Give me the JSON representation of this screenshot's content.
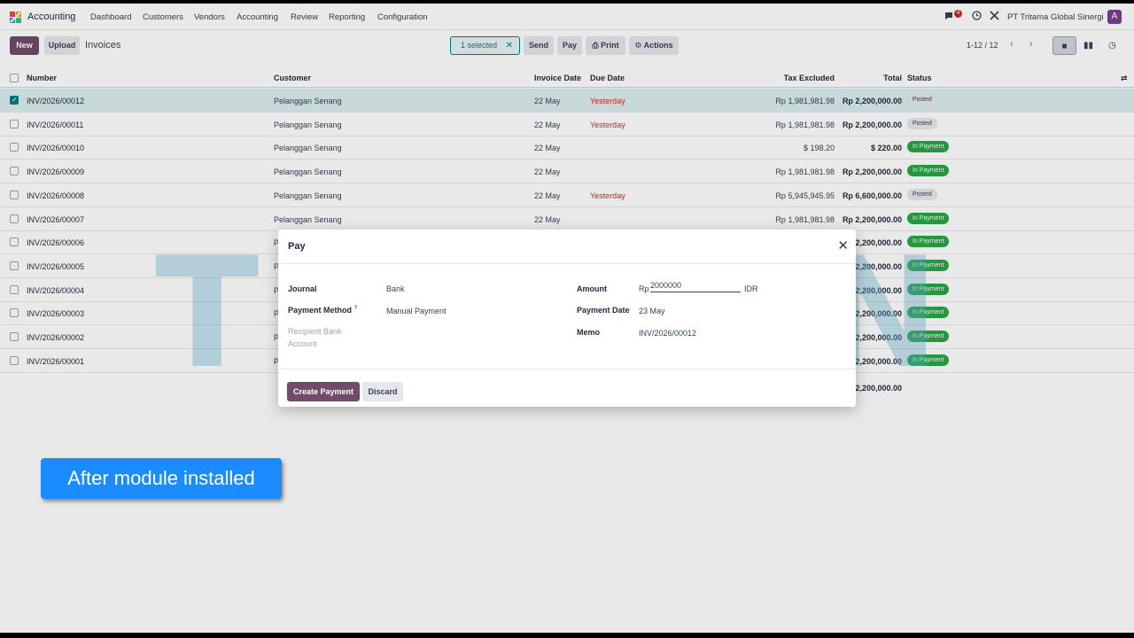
{
  "navbar": {
    "app_name": "Accounting",
    "menu": [
      "Dashboard",
      "Customers",
      "Vendors",
      "Accounting",
      "Review",
      "Reporting",
      "Configuration"
    ],
    "chat_badge": "4",
    "company": "PT Tritama Global Sinergi",
    "avatar_letter": "A"
  },
  "control": {
    "new_label": "New",
    "upload_label": "Upload",
    "title": "Invoices",
    "selected_label": "1 selected",
    "send_label": "Send",
    "pay_label": "Pay",
    "print_label": "Print",
    "actions_label": "Actions",
    "pager": "1-12 / 12"
  },
  "table": {
    "headers": {
      "number": "Number",
      "customer": "Customer",
      "invoice_date": "Invoice Date",
      "due_date": "Due Date",
      "tax_excluded": "Tax Excluded",
      "total": "Total",
      "status": "Status"
    },
    "rows": [
      {
        "number": "INV/2026/00012",
        "customer": "Pelanggan Senang",
        "invoice_date": "22 May",
        "due_date": "Yesterday",
        "tax_excluded": "Rp 1,981,981.98",
        "total": "Rp 2,200,000.00",
        "status": "Posted",
        "checked": true
      },
      {
        "number": "INV/2026/00011",
        "customer": "Pelanggan Senang",
        "invoice_date": "22 May",
        "due_date": "Yesterday",
        "tax_excluded": "Rp 1,981,981.98",
        "total": "Rp 2,200,000.00",
        "status": "Posted",
        "checked": false
      },
      {
        "number": "INV/2026/00010",
        "customer": "Pelanggan Senang",
        "invoice_date": "22 May",
        "due_date": "",
        "tax_excluded": "$ 198.20",
        "total": "$ 220.00",
        "status": "In Payment",
        "checked": false
      },
      {
        "number": "INV/2026/00009",
        "customer": "Pelanggan Senang",
        "invoice_date": "22 May",
        "due_date": "",
        "tax_excluded": "Rp 1,981,981.98",
        "total": "Rp 2,200,000.00",
        "status": "In Payment",
        "checked": false
      },
      {
        "number": "INV/2026/00008",
        "customer": "Pelanggan Senang",
        "invoice_date": "22 May",
        "due_date": "Yesterday",
        "tax_excluded": "Rp 5,945,945.95",
        "total": "Rp 6,600,000.00",
        "status": "Posted",
        "checked": false
      },
      {
        "number": "INV/2026/00007",
        "customer": "Pelanggan Senang",
        "invoice_date": "22 May",
        "due_date": "",
        "tax_excluded": "Rp 1,981,981.98",
        "total": "Rp 2,200,000.00",
        "status": "In Payment",
        "checked": false
      },
      {
        "number": "INV/2026/00006",
        "customer": "P",
        "invoice_date": "",
        "due_date": "",
        "tax_excluded": "",
        "total": "2,200,000.00",
        "status": "In Payment",
        "checked": false
      },
      {
        "number": "INV/2026/00005",
        "customer": "P",
        "invoice_date": "",
        "due_date": "",
        "tax_excluded": "",
        "total": "2,200,000.00",
        "status": "In Payment",
        "checked": false
      },
      {
        "number": "INV/2026/00004",
        "customer": "P",
        "invoice_date": "",
        "due_date": "",
        "tax_excluded": "",
        "total": "2,200,000.00",
        "status": "In Payment",
        "checked": false
      },
      {
        "number": "INV/2026/00003",
        "customer": "P",
        "invoice_date": "",
        "due_date": "",
        "tax_excluded": "",
        "total": "2,200,000.00",
        "status": "In Payment",
        "checked": false
      },
      {
        "number": "INV/2026/00002",
        "customer": "P",
        "invoice_date": "",
        "due_date": "",
        "tax_excluded": "",
        "total": "2,200,000.00",
        "status": "In Payment",
        "checked": false
      },
      {
        "number": "INV/2026/00001",
        "customer": "P",
        "invoice_date": "",
        "due_date": "",
        "tax_excluded": "",
        "total": "2,200,000.00",
        "status": "In Payment",
        "checked": false
      }
    ],
    "grand_total": "2,200,000.00"
  },
  "watermark": "TRIAGNO",
  "dialog": {
    "title": "Pay",
    "journal_label": "Journal",
    "journal_value": "Bank",
    "payment_method_label": "Payment Method",
    "payment_method_help": "?",
    "payment_method_value": "Manual Payment",
    "recipient_label_line1": "Recipient Bank",
    "recipient_label_line2": "Account",
    "amount_label": "Amount",
    "amount_prefix": "Rp",
    "amount_value": "2000000",
    "amount_currency": "IDR",
    "payment_date_label": "Payment Date",
    "payment_date_value": "23 May",
    "memo_label": "Memo",
    "memo_value": "INV/2026/00012",
    "create_label": "Create Payment",
    "discard_label": "Discard"
  },
  "caption": "After module installed",
  "colors": {
    "brand": "#714b67",
    "accent": "#017e84",
    "in_payment": "#28a745",
    "overdue": "#dc2626",
    "caption_bg": "#1a8cff"
  },
  "icons": [
    "app-logo-icon",
    "chat-icon",
    "clock-icon",
    "tools-icon",
    "close-icon",
    "print-icon",
    "gear-icon",
    "chevron-left-icon",
    "chevron-right-icon",
    "list-view-icon",
    "kanban-view-icon",
    "activity-view-icon",
    "column-settings-icon"
  ]
}
